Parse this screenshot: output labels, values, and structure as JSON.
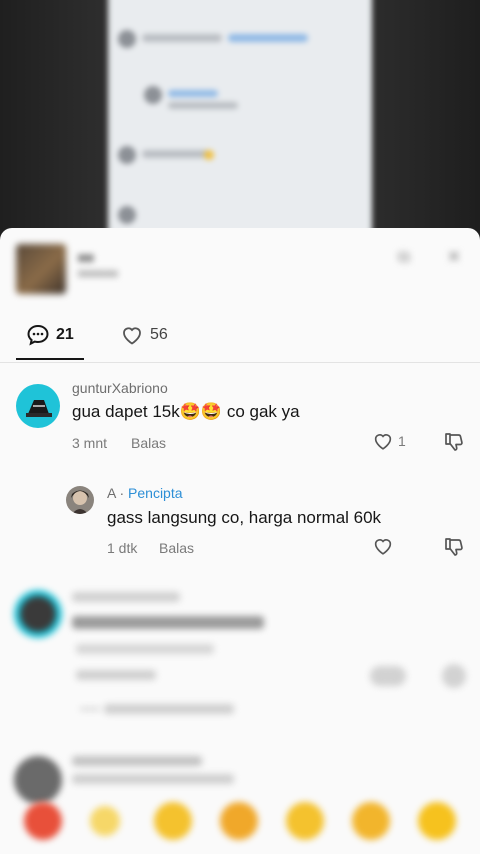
{
  "tabs": {
    "comments_count": "21",
    "likes_count": "56"
  },
  "comments": [
    {
      "username": "gunturXabriono",
      "text": "gua dapet 15k🤩🤩 co gak ya",
      "time": "3 mnt",
      "reply_label": "Balas",
      "likes": "1"
    }
  ],
  "reply": {
    "username_prefix": "A",
    "author_tag": "Pencipta",
    "text": "gass langsung co, harga normal 60k",
    "time": "1 dtk",
    "reply_label": "Balas"
  },
  "colors": {
    "author_tag": "#2d8fd6",
    "avatar_teal": "#1fc3d8",
    "sheet_bg": "#fafafa"
  },
  "icons": [
    "comment-icon",
    "heart-icon",
    "dislike-icon",
    "share-icon",
    "close-icon"
  ]
}
